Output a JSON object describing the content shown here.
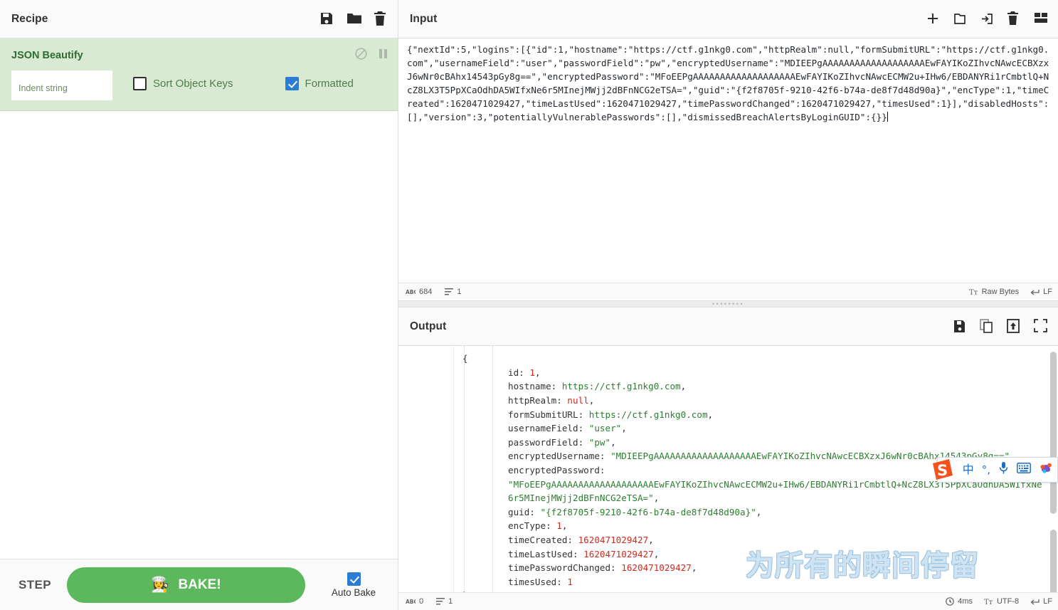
{
  "recipe": {
    "title": "Recipe",
    "icons": [
      {
        "name": "save-recipe-icon",
        "label": "save"
      },
      {
        "name": "load-recipe-icon",
        "label": "folder"
      },
      {
        "name": "clear-recipe-icon",
        "label": "trash"
      }
    ],
    "operations": [
      {
        "name": "JSON Beautify",
        "head_icons": [
          {
            "name": "disable-operation-icon",
            "label": "disable"
          },
          {
            "name": "pause-breakpoint-icon",
            "label": "breakpoint"
          }
        ],
        "args": {
          "indent_string_placeholder": "Indent string",
          "indent_string_value": "",
          "sort_object_keys_label": "Sort Object Keys",
          "sort_object_keys_checked": false,
          "formatted_label": "Formatted",
          "formatted_checked": true
        }
      }
    ],
    "controls": {
      "step_label": "STEP",
      "bake_label": "BAKE!",
      "bake_icon": "👩‍🍳",
      "auto_bake_label": "Auto Bake",
      "auto_bake_checked": true,
      "bake_color": "#5cb85c"
    }
  },
  "input": {
    "title": "Input",
    "icons": [
      {
        "name": "add-input-tab-icon",
        "label": "plus"
      },
      {
        "name": "open-folder-as-input-icon",
        "label": "folder"
      },
      {
        "name": "open-file-as-input-icon",
        "label": "open-file"
      },
      {
        "name": "clear-input-icon",
        "label": "trash"
      },
      {
        "name": "reset-pane-layout-icon",
        "label": "layout"
      }
    ],
    "text": "{\"nextId\":5,\"logins\":[{\"id\":1,\"hostname\":\"https://ctf.g1nkg0.com\",\"httpRealm\":null,\"formSubmitURL\":\"https://ctf.g1nkg0.com\",\"usernameField\":\"user\",\"passwordField\":\"pw\",\"encryptedUsername\":\"MDIEEPgAAAAAAAAAAAAAAAAAAAEwFAYIKoZIhvcNAwcECBXzxJ6wNr0cBAhx14543pGy8g==\",\"encryptedPassword\":\"MFoEEPgAAAAAAAAAAAAAAAAAAAEwFAYIKoZIhvcNAwcECMW2u+IHw6/EBDANYRi1rCmbtlQ+NcZ8LX3T5PpXCaOdhDA5WIfxNe6r5MInejMWjj2dBFnNCG2eTSA=\",\"guid\":\"{f2f8705f-9210-42f6-b74a-de8f7d48d90a}\",\"encType\":1,\"timeCreated\":1620471029427,\"timeLastUsed\":1620471029427,\"timePasswordChanged\":1620471029427,\"timesUsed\":1}],\"disabledHosts\":[],\"version\":3,\"potentiallyVulnerablePasswords\":[],\"dismissedBreachAlertsByLoginGUID\":{}}",
    "status": {
      "length_label": "684",
      "lines_label": "1",
      "raw_bytes_label": "Raw Bytes",
      "line_ending_label": "LF"
    }
  },
  "output": {
    "title": "Output",
    "icons": [
      {
        "name": "save-output-icon",
        "label": "save"
      },
      {
        "name": "copy-output-icon",
        "label": "copy"
      },
      {
        "name": "replace-input-with-output-icon",
        "label": "replace-input"
      },
      {
        "name": "maximise-output-icon",
        "label": "maximise"
      }
    ],
    "lines": [
      {
        "indent": 0,
        "fold": true,
        "parts": [
          {
            "t": "{",
            "c": "punc"
          }
        ]
      },
      {
        "indent": 2,
        "parts": [
          {
            "t": "id: ",
            "c": "k"
          },
          {
            "t": "1",
            "c": "num"
          },
          {
            "t": ",",
            "c": "punc"
          }
        ]
      },
      {
        "indent": 2,
        "parts": [
          {
            "t": "hostname: ",
            "c": "k"
          },
          {
            "t": "https://ctf.g1nkg0.com",
            "c": "str"
          },
          {
            "t": ",",
            "c": "punc"
          }
        ]
      },
      {
        "indent": 2,
        "parts": [
          {
            "t": "httpRealm: ",
            "c": "k"
          },
          {
            "t": "null",
            "c": "nul"
          },
          {
            "t": ",",
            "c": "punc"
          }
        ]
      },
      {
        "indent": 2,
        "parts": [
          {
            "t": "formSubmitURL: ",
            "c": "k"
          },
          {
            "t": "https://ctf.g1nkg0.com",
            "c": "str"
          },
          {
            "t": ",",
            "c": "punc"
          }
        ]
      },
      {
        "indent": 2,
        "parts": [
          {
            "t": "usernameField: ",
            "c": "k"
          },
          {
            "t": "\"user\"",
            "c": "str"
          },
          {
            "t": ",",
            "c": "punc"
          }
        ]
      },
      {
        "indent": 2,
        "parts": [
          {
            "t": "passwordField: ",
            "c": "k"
          },
          {
            "t": "\"pw\"",
            "c": "str"
          },
          {
            "t": ",",
            "c": "punc"
          }
        ]
      },
      {
        "indent": 2,
        "parts": [
          {
            "t": "encryptedUsername: ",
            "c": "k"
          },
          {
            "t": "\"MDIEEPgAAAAAAAAAAAAAAAAAAAEwFAYIKoZIhvcNAwcECBXzxJ6wNr0cBAhx14543pGy8g==\"",
            "c": "str"
          },
          {
            "t": ",",
            "c": "punc"
          }
        ]
      },
      {
        "indent": 2,
        "parts": [
          {
            "t": "encryptedPassword:",
            "c": "k"
          }
        ]
      },
      {
        "indent": 2,
        "wrap": true,
        "parts": [
          {
            "t": "\"MFoEEPgAAAAAAAAAAAAAAAAAAAEwFAYIKoZIhvcNAwcECMW2u+IHw6/EBDANYRi1rCmbtlQ+NcZ8LX3T5PpXCaOdhDA5WIfxNe6r5MInejMWjj2dBFnNCG2eTSA=\"",
            "c": "str"
          },
          {
            "t": ",",
            "c": "punc"
          }
        ]
      },
      {
        "indent": 2,
        "parts": [
          {
            "t": "guid: ",
            "c": "k"
          },
          {
            "t": "\"{f2f8705f-9210-42f6-b74a-de8f7d48d90a}\"",
            "c": "str"
          },
          {
            "t": ",",
            "c": "punc"
          }
        ]
      },
      {
        "indent": 2,
        "parts": [
          {
            "t": "encType: ",
            "c": "k"
          },
          {
            "t": "1",
            "c": "num"
          },
          {
            "t": ",",
            "c": "punc"
          }
        ]
      },
      {
        "indent": 2,
        "parts": [
          {
            "t": "timeCreated: ",
            "c": "k"
          },
          {
            "t": "1620471029427",
            "c": "num"
          },
          {
            "t": ",",
            "c": "punc"
          }
        ]
      },
      {
        "indent": 2,
        "parts": [
          {
            "t": "timeLastUsed: ",
            "c": "k"
          },
          {
            "t": "1620471029427",
            "c": "num"
          },
          {
            "t": ",",
            "c": "punc"
          }
        ]
      },
      {
        "indent": 2,
        "parts": [
          {
            "t": "timePasswordChanged: ",
            "c": "k"
          },
          {
            "t": "1620471029427",
            "c": "num"
          },
          {
            "t": ",",
            "c": "punc"
          }
        ]
      },
      {
        "indent": 2,
        "parts": [
          {
            "t": "timesUsed: ",
            "c": "k"
          },
          {
            "t": "1",
            "c": "num"
          }
        ]
      },
      {
        "indent": 0,
        "parts": [
          {
            "t": "}",
            "c": "punc"
          }
        ]
      }
    ],
    "status": {
      "length_label": "0",
      "lines_label": "1",
      "bake_time_label": "4ms",
      "encoding_label": "UTF-8",
      "line_ending_label": "LF"
    }
  },
  "watermark": {
    "text": "为所有的瞬间停留"
  },
  "ime": {
    "logo_letter": "S",
    "items": [
      {
        "name": "ime-logo-icon",
        "label": "S"
      },
      {
        "name": "ime-chinese-mode-icon",
        "label": "中"
      },
      {
        "name": "ime-punctuation-icon",
        "label": "°,"
      },
      {
        "name": "ime-voice-input-icon",
        "label": "mic"
      },
      {
        "name": "ime-soft-keyboard-icon",
        "label": "keyboard"
      },
      {
        "name": "ime-toolbox-icon",
        "label": "toolbox"
      }
    ]
  }
}
